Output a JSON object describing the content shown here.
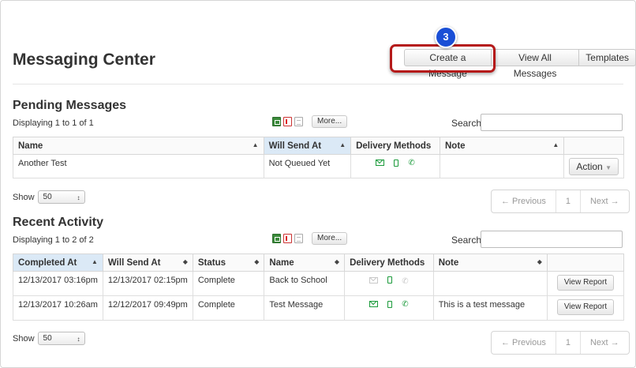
{
  "header": {
    "title": "Messaging Center",
    "buttons": [
      "Create a Message",
      "View All Messages",
      "Templates"
    ],
    "step_badge": "3"
  },
  "pending": {
    "title": "Pending Messages",
    "displaying": "Displaying 1 to 1 of 1",
    "more_label": "More...",
    "search_label": "Search",
    "columns": [
      "Name",
      "Will Send At",
      "Delivery Methods",
      "Note",
      ""
    ],
    "rows": [
      {
        "name": "Another Test",
        "will_send_at": "Not Queued Yet",
        "note": "",
        "action": "Action"
      }
    ],
    "show_label": "Show",
    "show_value": "50",
    "pager": {
      "prev": "← Previous",
      "page": "1",
      "next": "Next →"
    }
  },
  "recent": {
    "title": "Recent Activity",
    "displaying": "Displaying 1 to 2 of 2",
    "more_label": "More...",
    "search_label": "Search",
    "columns": [
      "Completed At",
      "Will Send At",
      "Status",
      "Name",
      "Delivery Methods",
      "Note",
      ""
    ],
    "rows": [
      {
        "completed_at": "12/13/2017 03:16pm",
        "will_send_at": "12/13/2017 02:15pm",
        "status": "Complete",
        "name": "Back to School",
        "note": "",
        "button": "View Report",
        "delivery": {
          "email": false,
          "sms": true,
          "voice": false
        }
      },
      {
        "completed_at": "12/13/2017 10:26am",
        "will_send_at": "12/12/2017 09:49pm",
        "status": "Complete",
        "name": "Test Message",
        "note": "This is a test message",
        "button": "View Report",
        "delivery": {
          "email": true,
          "sms": true,
          "voice": true
        }
      }
    ],
    "show_label": "Show",
    "show_value": "50",
    "pager": {
      "prev": "← Previous",
      "page": "1",
      "next": "Next →"
    }
  },
  "colors": {
    "accent": "#1a9a3a",
    "callout": "#b51a1a",
    "badge": "#1a4fd6",
    "sorted_header": "#dbe9f6"
  },
  "icons": [
    "excel-icon",
    "pdf-icon",
    "doc-icon",
    "email-icon",
    "sms-icon",
    "phone-icon",
    "sort-icon",
    "caret-down-icon"
  ]
}
